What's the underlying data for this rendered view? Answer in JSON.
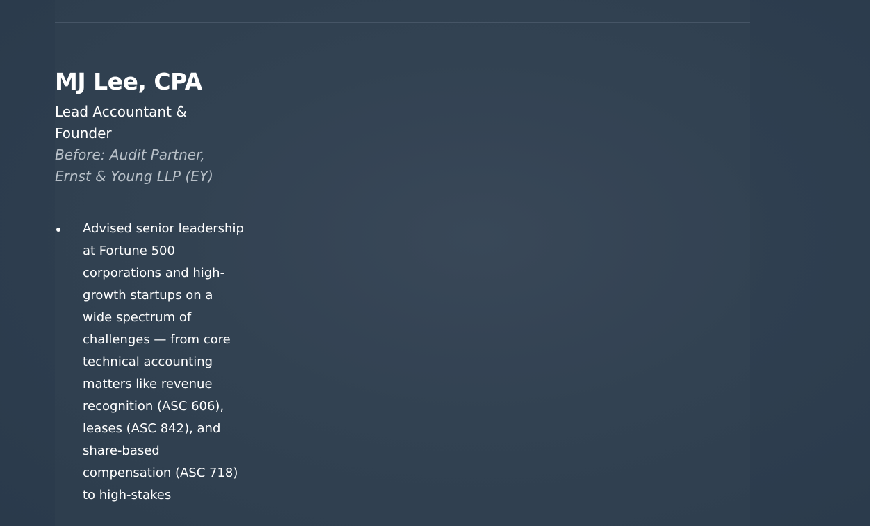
{
  "profile": {
    "name": "MJ Lee, CPA",
    "role": "Lead Accountant & Founder",
    "prior_role": "Before: Audit Partner, Ernst & Young LLP (EY)",
    "bullets": [
      "Advised senior leadership at Fortune 500 corporations and high-growth startups on a wide spectrum of challenges — from core technical accounting matters like revenue recognition (ASC 606), leases (ASC 842), and share-based compensation (ASC 718) to high-stakes"
    ]
  },
  "colors": {
    "background": "#2f3f50",
    "text": "#ffffff",
    "muted_text": "#b8c0c8",
    "divider": "#465566"
  }
}
